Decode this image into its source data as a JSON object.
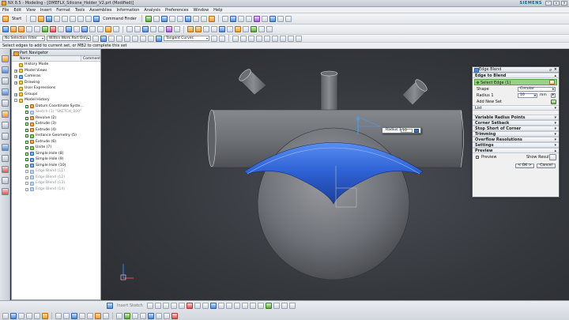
{
  "window": {
    "title": "NX 8.5 - Modeling - [DMEFLX_Silicone_Holder_V2.prt (Modified)]",
    "brand": "SIEMENS",
    "controls": [
      "–",
      "▫",
      "×"
    ]
  },
  "menubar": {
    "items": [
      "File",
      "Edit",
      "View",
      "Insert",
      "Format",
      "Tools",
      "Assemblies",
      "Information",
      "Analysis",
      "Preferences",
      "Window",
      "Help"
    ]
  },
  "toolbar1": {
    "start_label": "Start",
    "command_finder_label": "Command Finder"
  },
  "toolbar3": {
    "selection_filter": "No Selection Filter",
    "scope": "Within Work Part Only",
    "curve_rule": "Tangent Curves"
  },
  "prompt": "Select edges to add to current set, or MB2 to complete this set",
  "navigator": {
    "title": "Part Navigator",
    "col_name": "Name",
    "col_comment": "Comment",
    "rows": [
      {
        "label": "History Mode",
        "indent": 0,
        "expander": "",
        "check": false,
        "icon": "history",
        "dim": false
      },
      {
        "label": "Model Views",
        "indent": 0,
        "expander": "+",
        "check": false,
        "icon": "folder",
        "dim": false
      },
      {
        "label": "Cameras",
        "indent": 0,
        "expander": "+",
        "check": false,
        "icon": "camera",
        "dim": false
      },
      {
        "label": "Drawing",
        "indent": 0,
        "expander": "+",
        "check": false,
        "icon": "folder",
        "dim": false
      },
      {
        "label": "User Expressions",
        "indent": 0,
        "expander": "",
        "check": false,
        "icon": "folder",
        "dim": false
      },
      {
        "label": "Groups",
        "indent": 0,
        "expander": "+",
        "check": false,
        "icon": "folder",
        "dim": false
      },
      {
        "label": "Model History",
        "indent": 0,
        "expander": "-",
        "check": false,
        "icon": "folder",
        "dim": false
      },
      {
        "label": "Datum Coordinate Syste...",
        "indent": 1,
        "expander": "",
        "check": true,
        "icon": "datum",
        "dim": false
      },
      {
        "label": "Sketch (1) \"SKETCH_000\"",
        "indent": 1,
        "expander": "",
        "check": true,
        "icon": "sketch",
        "dim": true
      },
      {
        "label": "Revolve (2)",
        "indent": 1,
        "expander": "",
        "check": true,
        "icon": "revolve",
        "dim": false
      },
      {
        "label": "Extrude (3)",
        "indent": 1,
        "expander": "",
        "check": true,
        "icon": "extrude",
        "dim": false
      },
      {
        "label": "Extrude (4)",
        "indent": 1,
        "expander": "",
        "check": true,
        "icon": "extrude",
        "dim": false
      },
      {
        "label": "Instance Geometry (5)",
        "indent": 1,
        "expander": "",
        "check": true,
        "icon": "instance",
        "dim": false
      },
      {
        "label": "Extrude (6)",
        "indent": 1,
        "expander": "",
        "check": true,
        "icon": "extrude",
        "dim": false
      },
      {
        "label": "Unite (7)",
        "indent": 1,
        "expander": "",
        "check": true,
        "icon": "unite",
        "dim": false
      },
      {
        "label": "Simple Hole (8)",
        "indent": 1,
        "expander": "",
        "check": true,
        "icon": "hole",
        "dim": false
      },
      {
        "label": "Simple Hole (9)",
        "indent": 1,
        "expander": "",
        "check": true,
        "icon": "hole",
        "dim": false
      },
      {
        "label": "Simple Hole (10)",
        "indent": 1,
        "expander": "",
        "check": true,
        "icon": "hole",
        "dim": false
      },
      {
        "label": "Edge Blend (11)",
        "indent": 1,
        "expander": "",
        "check": false,
        "icon": "blend",
        "dim": true
      },
      {
        "label": "Edge Blend (12)",
        "indent": 1,
        "expander": "",
        "check": false,
        "icon": "blend",
        "dim": true
      },
      {
        "label": "Edge Blend (13)",
        "indent": 1,
        "expander": "",
        "check": false,
        "icon": "blend",
        "dim": true
      },
      {
        "label": "Edge Blend (14)",
        "indent": 1,
        "expander": "",
        "check": false,
        "icon": "blend",
        "dim": true
      }
    ]
  },
  "radius_callout": {
    "label": "Radius 1",
    "value": "10"
  },
  "dialog": {
    "title": "Edge Blend",
    "section_edge": "Edge to Blend",
    "select_edge": "Select Edge (1)",
    "shape_label": "Shape",
    "shape_value": "Circular",
    "radius_label": "Radius 1",
    "radius_value": "10",
    "radius_unit": "mm",
    "add_new_set": "Add New Set",
    "list_label": "List",
    "sections": [
      "Variable Radius Points",
      "Corner Setback",
      "Stop Short of Corner",
      "Trimming",
      "Overflow Resolutions",
      "Settings"
    ],
    "preview_section": "Preview",
    "preview_label": "Preview",
    "show_result": "Show Result",
    "ok": "< OK >",
    "cancel": "Cancel"
  },
  "bottombar": {
    "sketch_label": "Insert Sketch"
  },
  "colors": {
    "blend_face": "#2f63d6",
    "body_gray": "#7a7d82",
    "selection_green": "#9bd08a"
  }
}
